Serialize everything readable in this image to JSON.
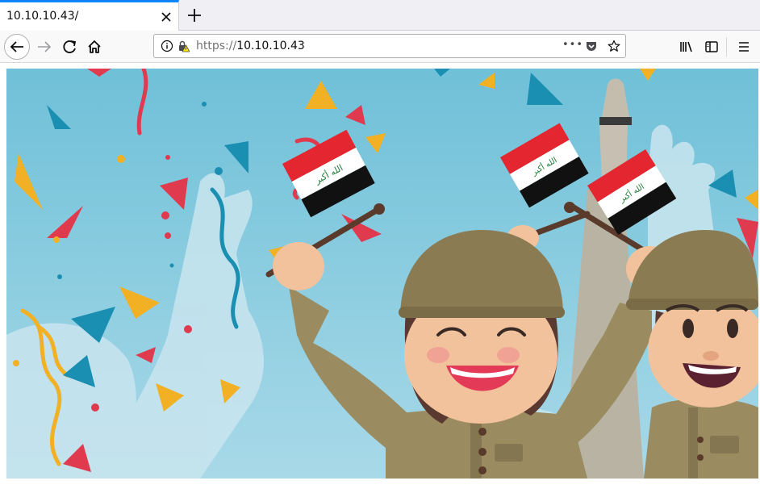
{
  "tab": {
    "title": "10.10.10.43/"
  },
  "toolbar": {
    "url_scheme": "https://",
    "url_host": "10.10.10.43",
    "page_actions": "•••"
  },
  "page": {
    "image_subject": "celebration-illustration",
    "flag_texts": [
      "الله أكبر",
      "الله أكبر",
      "الله أكبر"
    ]
  },
  "icons": [
    "close-icon",
    "plus-icon",
    "back-arrow-icon",
    "forward-arrow-icon",
    "reload-icon",
    "home-icon",
    "info-icon",
    "lock-warning-icon",
    "pocket-icon",
    "star-icon",
    "library-icon",
    "sidebar-icon",
    "hamburger-menu-icon"
  ],
  "colors": {
    "accent": "#0a84ff",
    "sky": "#7cc7dc",
    "helmet": "#8a7b52",
    "flag_red": "#e3262f"
  }
}
